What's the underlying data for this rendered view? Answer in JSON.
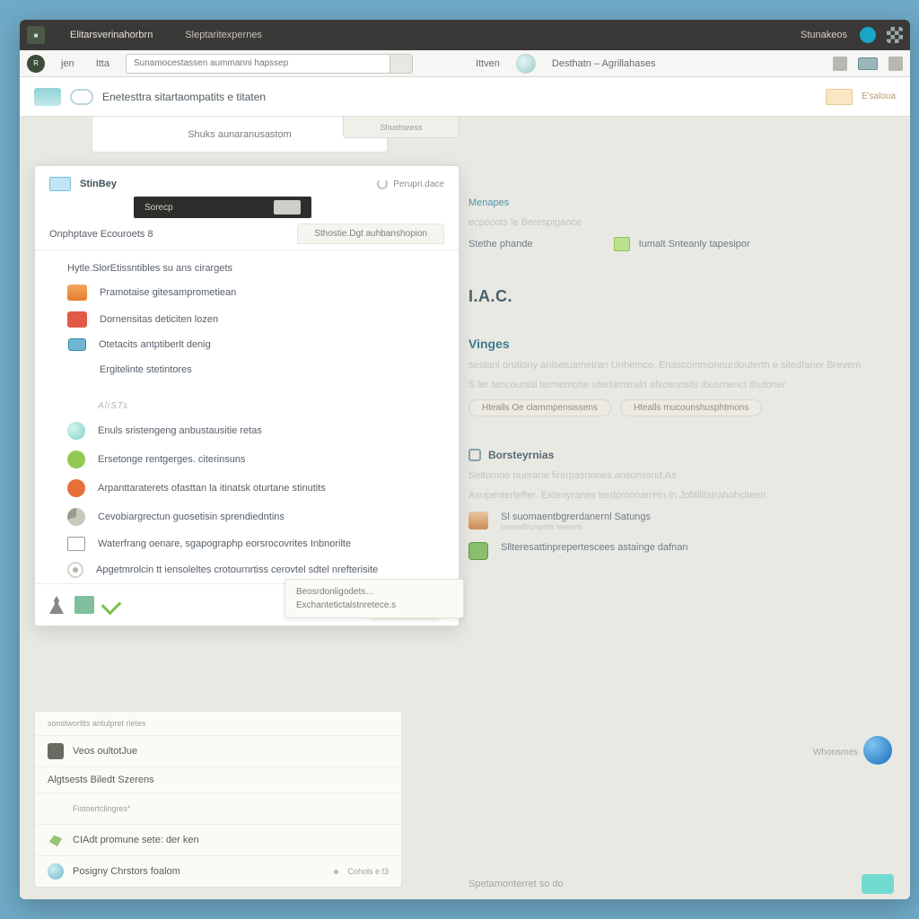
{
  "topbar": {
    "tab1": "Elitarsverinahorbrn",
    "tab2": "Sleptaritexpernes",
    "right_label": "Stunakeos"
  },
  "subbar": {
    "badge": "R",
    "mode1": "jen",
    "mode2": "Itta",
    "search_placeholder": "Sunamocestassen aummanni hapssep",
    "filter": "Ittven",
    "crumb": "Desthatn – Agrillahases"
  },
  "titlestrip": {
    "title": "Enetesttra sitartaompatits e titaten",
    "right": "E'saloua"
  },
  "canvas": {
    "crumb": "Shuks aunaranusastom",
    "crumb2": "Shushsress",
    "link1": "Menapes",
    "link1_sub": "ecpecots le Berespigance",
    "row_plain": "Stethe phande",
    "row_inline_label": "Iumalt Snteanly tapesipor",
    "h2": "I.A.C.",
    "h3": "Vinges",
    "ghost_line1": "sestanl orotlony anisetuametran Unhemce, Enascommonnurdoutertn e sitedfaner Brevem",
    "ghost_line2": "S ler tencountal lermemohe uterfamsraln afscennslls Ibusmenct Ihutoner",
    "pill1": "Htealls Oe clammpensissens",
    "pill2": "Htealls mucounshusphtmons",
    "panel_head": "Borsteyrnias",
    "panel_t1": "Seltomno nuerane firerpasnones ansonssnd.As",
    "panel_t2": "Asupentertefter. Extenyranes terdomonarretn.ln Jofitilitstrahohclteen",
    "file1": "Sl suomaentbgrerdanernl Satungs",
    "file1_sub": "Isersaff/unpettr teerers",
    "file2": "Sllteresattinprepertescees astainge dafnan",
    "status": "Whonsmes",
    "footer_text": "Spetamonterret so do",
    "footer_chip": ""
  },
  "panelL": {
    "head": "StinBey",
    "head_pill": "Perupri.dace",
    "darktab": "Sorecp",
    "subhead": "Onphptave Ecouroets 8",
    "subhead_tab": "Sthostie.Dgt auhbanshopion",
    "group1": "Hytle.SlorEtissntibles su ans cirargets",
    "items1": [
      "Pramotaise gitesamprometiean",
      "Dornensitas deticiten lozen",
      "Otetacits antptiberlt denig",
      "Ergitelinte stetintores"
    ],
    "group2_hdr": "AliSTs",
    "items2": [
      "Enuls sristengeng anbustausitie retas",
      "Ersetonge rentgerges. citerinsuns",
      "Arpanttaraterets ofasttan la itinatsk oturtane stinutits",
      "Cevobiargrectun guosetisin sprendiedntins",
      "Waterfrang oenare, sgapographp eorsrocovrites Inbnorilte",
      "Apgetmrolcin tt iensoleltes crotournrtiss cerovtel sdtel nrefterisite"
    ],
    "tooltip_l1": "Beosrdonligodets…",
    "tooltip_l2": "Exchantetictalstnretece.s"
  },
  "lower": {
    "r1": "sonstworltts aritulpret rietes",
    "r2": "Veos oultotJue",
    "r3": "Algtsests Biledt Szerens",
    "r4": "Fistoertclingres*",
    "r5": "CIAdt promune sete: der ken",
    "r6": "Posigny Chrstors foalom",
    "r6b": "Cohols e f3"
  }
}
